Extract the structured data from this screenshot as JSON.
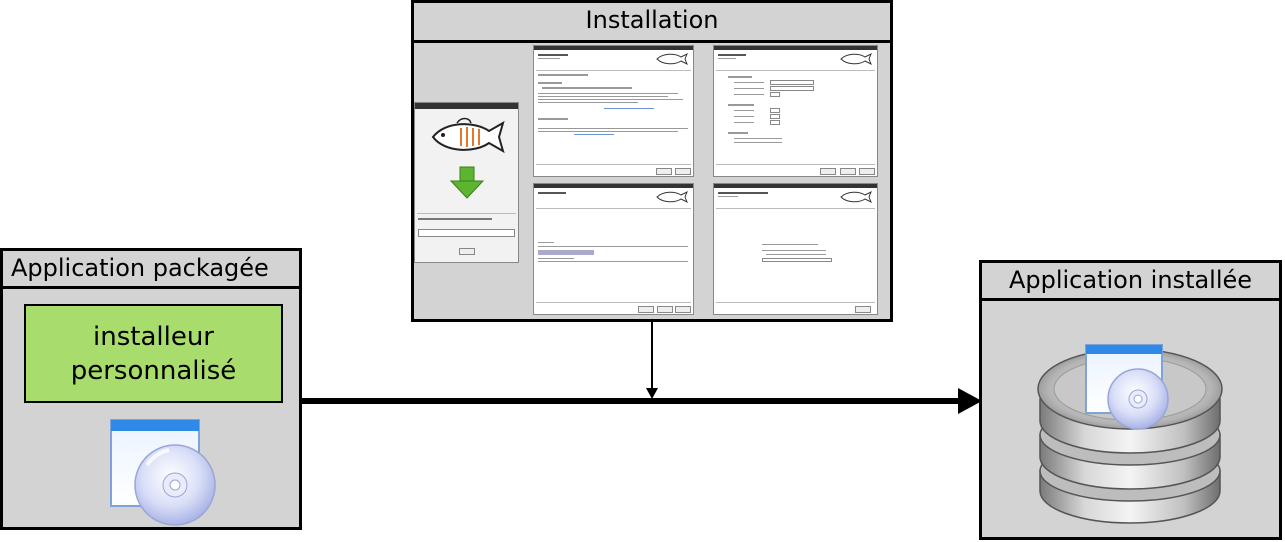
{
  "boxes": {
    "packaged": {
      "title": "Application packagée",
      "installer_line1": "installeur",
      "installer_line2": "personnalisé"
    },
    "installation": {
      "title": "Installation"
    },
    "installed": {
      "title": "Application installée"
    }
  },
  "colors": {
    "box_fill": "#d3d3d3",
    "installer_fill": "#a8dc6c",
    "arrow": "#000000",
    "cd_icon": "cd-package-icon",
    "db_icon": "database-stack-icon"
  }
}
